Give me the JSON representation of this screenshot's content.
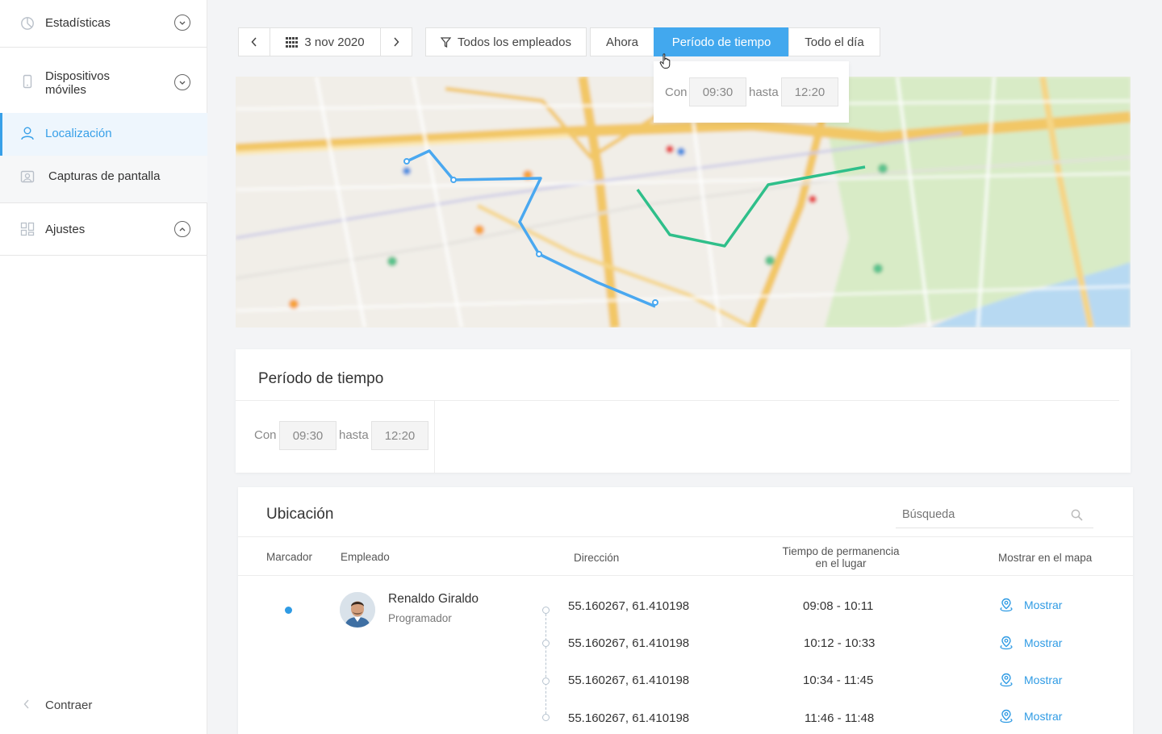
{
  "sidebar": {
    "items": [
      {
        "label": "Estadísticas",
        "icon": "pie-chart-icon"
      },
      {
        "label": "Dispositivos móviles",
        "icon": "mobile-icon"
      },
      {
        "label": "Localización",
        "icon": "user-icon"
      },
      {
        "label": "Capturas de pantalla",
        "icon": "screenshot-icon"
      },
      {
        "label": "Ajustes",
        "icon": "settings-grid-icon"
      }
    ],
    "collapse_label": "Contraer"
  },
  "toolbar": {
    "date": "3 nov 2020",
    "employees_filter": "Todos los empleados",
    "tabs": [
      "Ahora",
      "Período de tiempo",
      "Todo el día"
    ],
    "active_tab": "Período de tiempo"
  },
  "popover": {
    "from_label": "Con",
    "from": "09:30",
    "to_label": "hasta",
    "to": "12:20"
  },
  "period_card": {
    "title": "Período de tiempo",
    "from_label": "Con",
    "from": "09:30",
    "to_label": "hasta",
    "to": "12:20"
  },
  "location_card": {
    "title": "Ubicación",
    "search_placeholder": "Búsqueda",
    "columns": {
      "marker": "Marcador",
      "employee": "Empleado",
      "address": "Dirección",
      "time_line1": "Tiempo de permanencia",
      "time_line2": "en el lugar",
      "show": "Mostrar en el mapa"
    },
    "employee": {
      "name": "Renaldo Giraldo",
      "role": "Programador"
    },
    "rows": [
      {
        "address": "55.160267, 61.410198",
        "time": "09:08 - 10:11",
        "action": "Mostrar"
      },
      {
        "address": "55.160267, 61.410198",
        "time": "10:12 - 10:33",
        "action": "Mostrar"
      },
      {
        "address": "55.160267, 61.410198",
        "time": "10:34 - 11:45",
        "action": "Mostrar"
      },
      {
        "address": "55.160267, 61.410198",
        "time": "11:46 - 11:48",
        "action": "Mostrar"
      }
    ]
  },
  "colors": {
    "accent": "#42a8ee",
    "route_blue": "#4aa8f0",
    "route_green": "#2fbf8a"
  }
}
